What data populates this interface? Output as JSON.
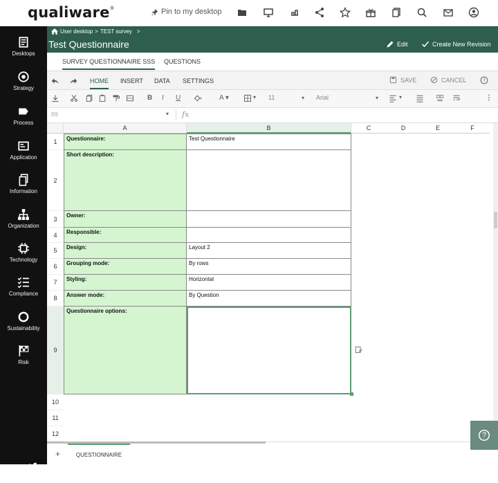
{
  "app": {
    "logo": "qualiware",
    "logo_tm": "®",
    "pin_label": "Pin to my desktop"
  },
  "sidebar": {
    "items": [
      {
        "label": "Desktops",
        "icon": "desktop-icon"
      },
      {
        "label": "Strategy",
        "icon": "target-icon"
      },
      {
        "label": "Process",
        "icon": "process-arrow-icon"
      },
      {
        "label": "Application",
        "icon": "application-icon"
      },
      {
        "label": "Information",
        "icon": "documents-icon"
      },
      {
        "label": "Organization",
        "icon": "org-chart-icon"
      },
      {
        "label": "Technology",
        "icon": "chip-icon"
      },
      {
        "label": "Compliance",
        "icon": "checklist-icon"
      },
      {
        "label": "Sustainability",
        "icon": "ring-icon"
      },
      {
        "label": "Risk",
        "icon": "checkered-flag-icon"
      }
    ],
    "brand": "qw"
  },
  "header": {
    "breadcrumb": [
      "User desktop",
      ">",
      "TEST survey",
      ">"
    ],
    "title": "Test Questionnaire",
    "edit_label": "Edit",
    "create_revision_label": "Create New Revision"
  },
  "tabs": {
    "primary": [
      "SURVEY QUESTIONNAIRE SSS",
      "QUESTIONS"
    ]
  },
  "ribbon": {
    "tabs": [
      "HOME",
      "INSERT",
      "DATA",
      "SETTINGS"
    ],
    "save_label": "SAVE",
    "cancel_label": "CANCEL",
    "font_size": "11",
    "font_name": "Arial"
  },
  "formula": {
    "cell_ref": "B9",
    "fx": "fx"
  },
  "sheet": {
    "columns": [
      "A",
      "B",
      "C",
      "D",
      "E",
      "F"
    ],
    "rows": [
      {
        "n": "1",
        "a": "Questionnaire:",
        "b": "Test Questionnaire"
      },
      {
        "n": "2",
        "a": "Short description:",
        "b": ""
      },
      {
        "n": "3",
        "a": "Owner:",
        "b": ""
      },
      {
        "n": "4",
        "a": "Responsible:",
        "b": ""
      },
      {
        "n": "5",
        "a": "Design:",
        "b": "Layout 2"
      },
      {
        "n": "6",
        "a": "Grouping mode:",
        "b": "By rows"
      },
      {
        "n": "7",
        "a": "Styling:",
        "b": "Horizontal"
      },
      {
        "n": "8",
        "a": "Answer mode:",
        "b": "By Question"
      },
      {
        "n": "9",
        "a": "Questionnaire options:",
        "b": ""
      }
    ],
    "empty_rows": [
      "10",
      "11",
      "12"
    ],
    "sheet_tab": "QUESTIONNAIRE",
    "add_sheet": "+"
  },
  "help": "?"
}
